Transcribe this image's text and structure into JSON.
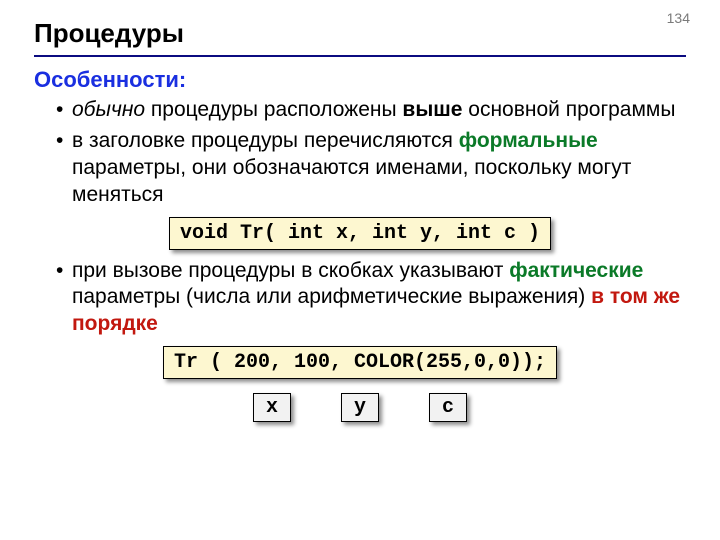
{
  "page_number": "134",
  "title": "Процедуры",
  "subheading": "Особенности:",
  "bullets": {
    "b1": {
      "em": "обычно",
      "rest1": " процедуры расположены ",
      "bold": "выше",
      "rest2": " основной программы"
    },
    "b2": {
      "pre": "в заголовке процедуры перечисляются ",
      "green": "формальные",
      "post": " параметры, они обозначаются именами, поскольку могут меняться"
    },
    "b3": {
      "pre": "при вызове процедуры в скобках указывают ",
      "green": "фактические",
      "mid": " параметры (числа или арифметические выражения) ",
      "red": "в том же порядке"
    }
  },
  "code1": "void Tr( int x, int y, int c )",
  "code2": "Tr ( 200, 100, COLOR(255,0,0));",
  "vars": {
    "x": "x",
    "y": "y",
    "c": "c"
  }
}
